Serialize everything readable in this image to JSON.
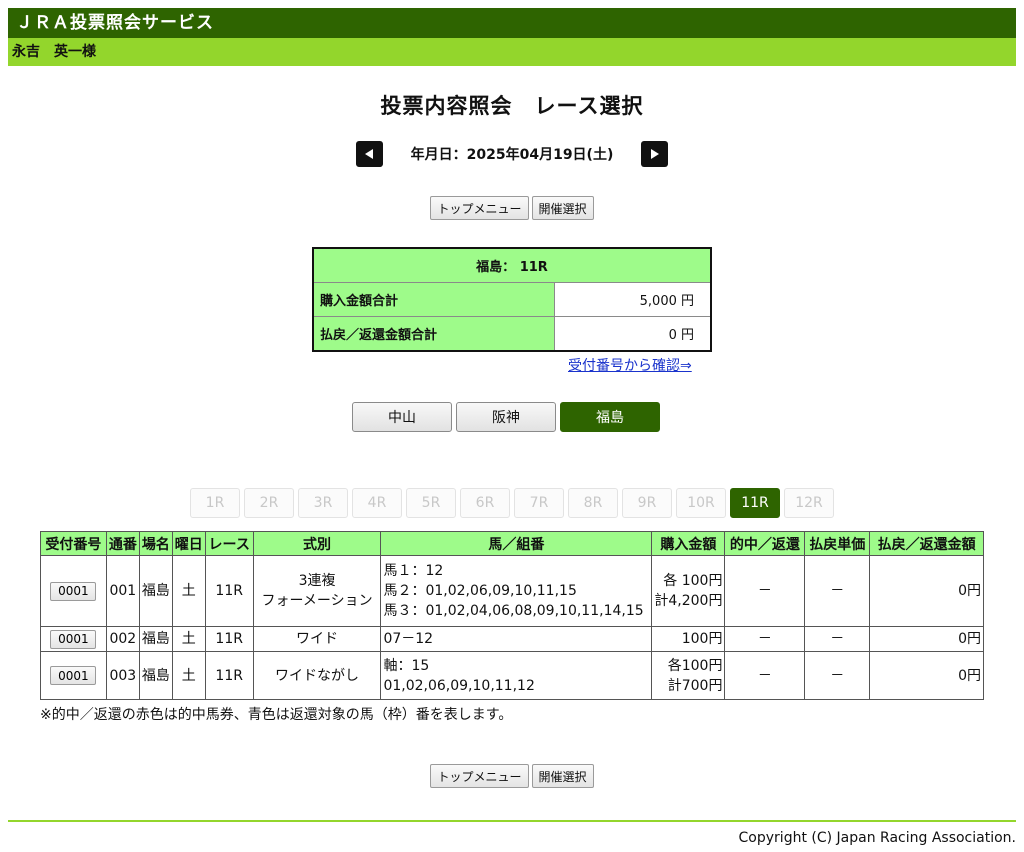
{
  "header": {
    "service_title": "ＪＲＡ投票照会サービス",
    "user_name": "永吉　英一様"
  },
  "page_title": "投票内容照会　レース選択",
  "date_nav": {
    "label": "年月日：2025年04月19日(土)",
    "prev_icon": "triangle-left-icon",
    "next_icon": "triangle-right-icon"
  },
  "nav_buttons": {
    "top_menu": "トップメニュー",
    "venue_select": "開催選択"
  },
  "summary": {
    "title": "福島： 11R",
    "rows": [
      {
        "label": "購入金額合計",
        "value": "5,000 円"
      },
      {
        "label": "払戻／返還金額合計",
        "value": "0 円"
      }
    ]
  },
  "receipt_link": "受付番号から確認⇒",
  "venues": [
    {
      "label": "中山",
      "active": false
    },
    {
      "label": "阪神",
      "active": false
    },
    {
      "label": "福島",
      "active": true
    }
  ],
  "races": [
    "1R",
    "2R",
    "3R",
    "4R",
    "5R",
    "6R",
    "7R",
    "8R",
    "9R",
    "10R",
    "11R",
    "12R"
  ],
  "active_race": "11R",
  "table": {
    "headers": [
      "受付番号",
      "通番",
      "場名",
      "曜日",
      "レース",
      "式別",
      "馬／組番",
      "購入金額",
      "的中／返還",
      "払戻単価",
      "払戻／返還金額"
    ],
    "rows": [
      {
        "receipt": "0001",
        "seq": "001",
        "venue": "福島",
        "day": "土",
        "race": "11R",
        "type_lines": [
          "3連複",
          "フォーメーション"
        ],
        "horse_lines": [
          "馬１：12",
          "馬２：01,02,06,09,10,11,15",
          "馬３：01,02,04,06,08,09,10,11,14,15"
        ],
        "amount_lines": [
          "各 100円",
          "計4,200円"
        ],
        "hit": "－",
        "unit": "－",
        "payout": "0円"
      },
      {
        "receipt": "0001",
        "seq": "002",
        "venue": "福島",
        "day": "土",
        "race": "11R",
        "type_lines": [
          "ワイド"
        ],
        "horse_lines": [
          "07－12"
        ],
        "amount_lines": [
          "100円"
        ],
        "hit": "－",
        "unit": "－",
        "payout": "0円"
      },
      {
        "receipt": "0001",
        "seq": "003",
        "venue": "福島",
        "day": "土",
        "race": "11R",
        "type_lines": [
          "ワイドながし"
        ],
        "horse_lines": [
          "軸：15",
          "01,02,06,09,10,11,12"
        ],
        "amount_lines": [
          "各100円",
          "計700円"
        ],
        "hit": "－",
        "unit": "－",
        "payout": "0円"
      }
    ]
  },
  "note": "※的中／返還の赤色は的中馬券、青色は返還対象の馬（枠）番を表します。",
  "copyright": "Copyright (C) Japan Racing Association.",
  "colors": {
    "dark_green": "#2e6400",
    "light_green": "#93d62c",
    "table_header": "#9efb8a",
    "link": "#1a33cc"
  }
}
